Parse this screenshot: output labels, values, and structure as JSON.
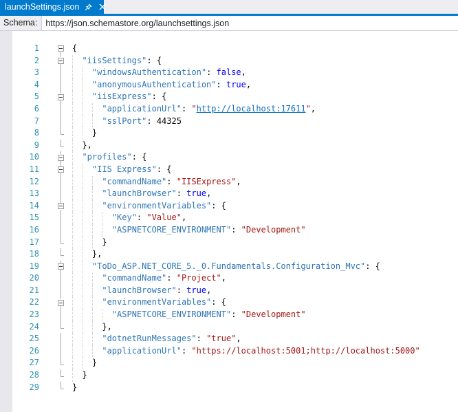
{
  "tab": {
    "title": "launchSettings.json",
    "pin_icon": "pin-icon",
    "close_icon": "close-icon"
  },
  "schema": {
    "label": "Schema:",
    "value": "https://json.schemastore.org/launchsettings.json"
  },
  "colors": {
    "accent": "#007ACC",
    "strip_bg": "#EEEEF2",
    "border": "#CCCEDB",
    "margin_bg": "#E8E8EC",
    "line_number": "#2B91AF",
    "property": "#2E75B6",
    "string": "#A31515",
    "keyword": "#0000FF",
    "link": "#0E70C0",
    "fold_line": "#A5A5A5"
  },
  "editor": {
    "lines": [
      {
        "n": 1,
        "fold": "box1",
        "indent": 0,
        "tokens": [
          [
            "p",
            "{"
          ]
        ]
      },
      {
        "n": 2,
        "fold": "box",
        "indent": 2,
        "tokens": [
          [
            "k",
            "\"iisSettings\""
          ],
          [
            "p",
            ": {"
          ]
        ]
      },
      {
        "n": 3,
        "fold": "line",
        "indent": 4,
        "tokens": [
          [
            "k",
            "\"windowsAuthentication\""
          ],
          [
            "p",
            ": "
          ],
          [
            "b",
            "false"
          ],
          [
            "p",
            ","
          ]
        ]
      },
      {
        "n": 4,
        "fold": "line",
        "indent": 4,
        "tokens": [
          [
            "k",
            "\"anonymousAuthentication\""
          ],
          [
            "p",
            ": "
          ],
          [
            "b",
            "true"
          ],
          [
            "p",
            ","
          ]
        ]
      },
      {
        "n": 5,
        "fold": "box",
        "indent": 4,
        "tokens": [
          [
            "k",
            "\"iisExpress\""
          ],
          [
            "p",
            ": {"
          ]
        ]
      },
      {
        "n": 6,
        "fold": "line",
        "indent": 6,
        "tokens": [
          [
            "k",
            "\"applicationUrl\""
          ],
          [
            "p",
            ": "
          ],
          [
            "s",
            "\""
          ],
          [
            "l",
            "http://localhost:17611"
          ],
          [
            "s",
            "\""
          ],
          [
            "p",
            ","
          ]
        ]
      },
      {
        "n": 7,
        "fold": "line",
        "indent": 6,
        "tokens": [
          [
            "k",
            "\"sslPort\""
          ],
          [
            "p",
            ": "
          ],
          [
            "n",
            "44325"
          ]
        ]
      },
      {
        "n": 8,
        "fold": "end",
        "indent": 4,
        "tokens": [
          [
            "p",
            "}"
          ]
        ]
      },
      {
        "n": 9,
        "fold": "end",
        "indent": 2,
        "tokens": [
          [
            "p",
            "},"
          ]
        ]
      },
      {
        "n": 10,
        "fold": "box",
        "indent": 2,
        "tokens": [
          [
            "k",
            "\"profiles\""
          ],
          [
            "p",
            ": {"
          ]
        ]
      },
      {
        "n": 11,
        "fold": "box",
        "indent": 4,
        "tokens": [
          [
            "k",
            "\"IIS Express\""
          ],
          [
            "p",
            ": {"
          ]
        ]
      },
      {
        "n": 12,
        "fold": "line",
        "indent": 6,
        "tokens": [
          [
            "k",
            "\"commandName\""
          ],
          [
            "p",
            ": "
          ],
          [
            "s",
            "\"IISExpress\""
          ],
          [
            "p",
            ","
          ]
        ]
      },
      {
        "n": 13,
        "fold": "line",
        "indent": 6,
        "tokens": [
          [
            "k",
            "\"launchBrowser\""
          ],
          [
            "p",
            ": "
          ],
          [
            "b",
            "true"
          ],
          [
            "p",
            ","
          ]
        ]
      },
      {
        "n": 14,
        "fold": "box",
        "indent": 6,
        "tokens": [
          [
            "k",
            "\"environmentVariables\""
          ],
          [
            "p",
            ": {"
          ]
        ]
      },
      {
        "n": 15,
        "fold": "line",
        "indent": 8,
        "tokens": [
          [
            "k",
            "\"Key\""
          ],
          [
            "p",
            ": "
          ],
          [
            "s",
            "\"Value\""
          ],
          [
            "p",
            ","
          ]
        ]
      },
      {
        "n": 16,
        "fold": "line",
        "indent": 8,
        "tokens": [
          [
            "k",
            "\"ASPNETCORE_ENVIRONMENT\""
          ],
          [
            "p",
            ": "
          ],
          [
            "s",
            "\"Development\""
          ]
        ]
      },
      {
        "n": 17,
        "fold": "end",
        "indent": 6,
        "tokens": [
          [
            "p",
            "}"
          ]
        ]
      },
      {
        "n": 18,
        "fold": "end",
        "indent": 4,
        "tokens": [
          [
            "p",
            "},"
          ]
        ]
      },
      {
        "n": 19,
        "fold": "box",
        "indent": 4,
        "tokens": [
          [
            "k",
            "\"ToDo_ASP.NET_CORE_5._0.Fundamentals.Configuration_Mvc\""
          ],
          [
            "p",
            ": {"
          ]
        ]
      },
      {
        "n": 20,
        "fold": "line",
        "indent": 6,
        "tokens": [
          [
            "k",
            "\"commandName\""
          ],
          [
            "p",
            ": "
          ],
          [
            "s",
            "\"Project\""
          ],
          [
            "p",
            ","
          ]
        ]
      },
      {
        "n": 21,
        "fold": "line",
        "indent": 6,
        "tokens": [
          [
            "k",
            "\"launchBrowser\""
          ],
          [
            "p",
            ": "
          ],
          [
            "b",
            "true"
          ],
          [
            "p",
            ","
          ]
        ]
      },
      {
        "n": 22,
        "fold": "box",
        "indent": 6,
        "tokens": [
          [
            "k",
            "\"environmentVariables\""
          ],
          [
            "p",
            ": {"
          ]
        ]
      },
      {
        "n": 23,
        "fold": "line",
        "indent": 8,
        "tokens": [
          [
            "k",
            "\"ASPNETCORE_ENVIRONMENT\""
          ],
          [
            "p",
            ": "
          ],
          [
            "s",
            "\"Development\""
          ]
        ]
      },
      {
        "n": 24,
        "fold": "end",
        "indent": 6,
        "tokens": [
          [
            "p",
            "},"
          ]
        ]
      },
      {
        "n": 25,
        "fold": "line",
        "indent": 6,
        "tokens": [
          [
            "k",
            "\"dotnetRunMessages\""
          ],
          [
            "p",
            ": "
          ],
          [
            "s",
            "\"true\""
          ],
          [
            "p",
            ","
          ]
        ]
      },
      {
        "n": 26,
        "fold": "line",
        "indent": 6,
        "tokens": [
          [
            "k",
            "\"applicationUrl\""
          ],
          [
            "p",
            ": "
          ],
          [
            "s",
            "\"https://localhost:5001;http://localhost:5000\""
          ]
        ]
      },
      {
        "n": 27,
        "fold": "end",
        "indent": 4,
        "tokens": [
          [
            "p",
            "}"
          ]
        ]
      },
      {
        "n": 28,
        "fold": "end",
        "indent": 2,
        "tokens": [
          [
            "p",
            "}"
          ]
        ]
      },
      {
        "n": 29,
        "fold": "end",
        "indent": 0,
        "tokens": [
          [
            "p",
            "}"
          ]
        ]
      }
    ]
  }
}
